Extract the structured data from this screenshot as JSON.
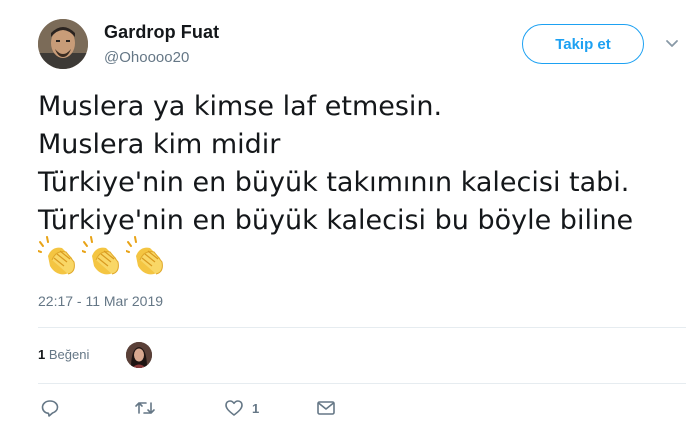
{
  "author": {
    "display_name": "Gardrop Fuat",
    "handle": "@Ohoooo20"
  },
  "follow_button": {
    "label": "Takip et",
    "color": "#1da1f2"
  },
  "tweet": {
    "lines": [
      "Muslera ya kimse laf etmesin.",
      "Muslera kim midir",
      "Türkiye'nin en büyük takımının kalecisi tabi.",
      "Türkiye'nin en büyük kalecisi bu böyle biline"
    ],
    "emojis": [
      "clapping-hands",
      "clapping-hands",
      "clapping-hands"
    ],
    "timestamp": "22:17 - 11 Mar 2019"
  },
  "stats": {
    "like_count": "1",
    "like_label": "Beğeni"
  },
  "actions": {
    "reply_count": "",
    "retweet_count": "",
    "like_count": "1",
    "message_count": ""
  },
  "colors": {
    "text": "#14171a",
    "secondary": "#657786",
    "divider": "#e6ecf0"
  }
}
